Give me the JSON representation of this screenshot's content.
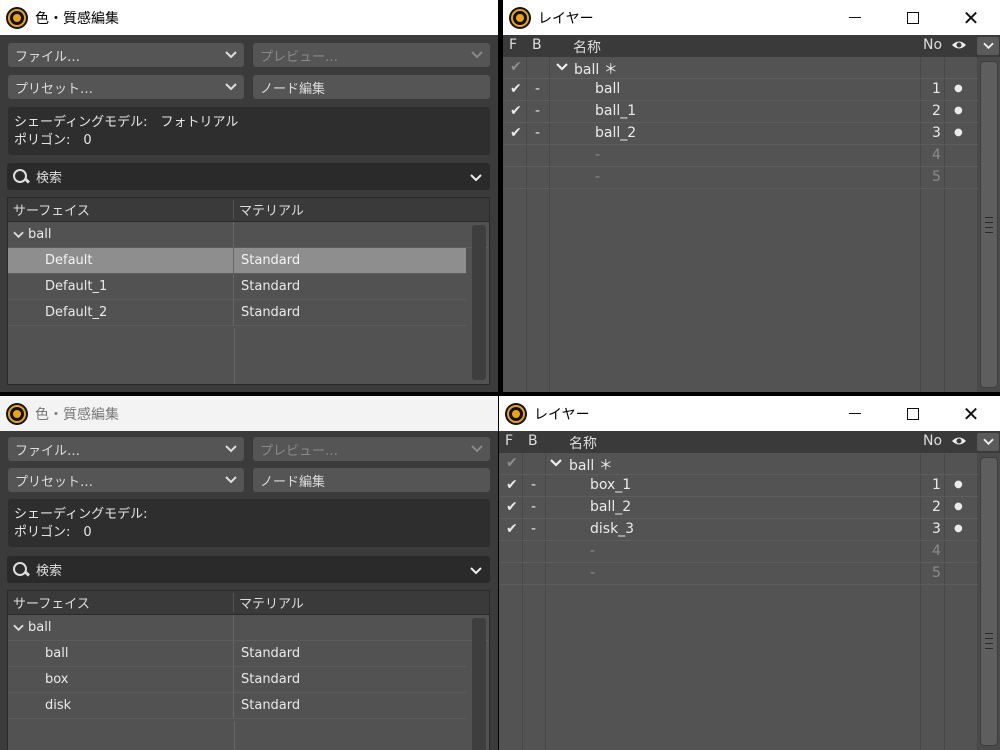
{
  "material_windows": [
    {
      "title": "色・質感編集",
      "file_label": "ファイル…",
      "preview_label": "プレビュー…",
      "preset_label": "プリセット…",
      "node_edit_label": "ノード編集",
      "info_line1": "シェーディングモデル:　フォトリアル",
      "info_line2": "ポリゴン:　0",
      "search_placeholder": "検索",
      "col_surface": "サーフェイス",
      "col_material": "マテリアル",
      "group": "ball",
      "rows": [
        {
          "surface": "Default",
          "material": "Standard"
        },
        {
          "surface": "Default_1",
          "material": "Standard"
        },
        {
          "surface": "Default_2",
          "material": "Standard"
        }
      ]
    },
    {
      "title": "色・質感編集",
      "file_label": "ファイル…",
      "preview_label": "プレビュー…",
      "preset_label": "プリセット…",
      "node_edit_label": "ノード編集",
      "info_line1": "シェーディングモデル:",
      "info_line2": "ポリゴン:　0",
      "search_placeholder": "検索",
      "col_surface": "サーフェイス",
      "col_material": "マテリアル",
      "group": "ball",
      "rows": [
        {
          "surface": "ball",
          "material": "Standard"
        },
        {
          "surface": "box",
          "material": "Standard"
        },
        {
          "surface": "disk",
          "material": "Standard"
        }
      ]
    }
  ],
  "layer_windows": [
    {
      "title": "レイヤー",
      "col_f": "F",
      "col_b": "B",
      "col_name": "名称",
      "col_no": "No",
      "group": "ball ＊",
      "check": "✔",
      "dash": "-",
      "dot": "●",
      "layers": [
        {
          "name": "ball",
          "no": "1"
        },
        {
          "name": "ball_1",
          "no": "2"
        },
        {
          "name": "ball_2",
          "no": "3"
        },
        {
          "name": "-",
          "no": "4"
        },
        {
          "name": "-",
          "no": "5"
        }
      ]
    },
    {
      "title": "レイヤー",
      "col_f": "F",
      "col_b": "B",
      "col_name": "名称",
      "col_no": "No",
      "group": "ball ＊",
      "check": "✔",
      "dash": "-",
      "dot": "●",
      "layers": [
        {
          "name": "box_1",
          "no": "1"
        },
        {
          "name": "ball_2",
          "no": "2"
        },
        {
          "name": "disk_3",
          "no": "3"
        },
        {
          "name": "-",
          "no": "4"
        },
        {
          "name": "-",
          "no": "5"
        }
      ]
    }
  ],
  "window_controls": {
    "minimize": "—",
    "maximize": "□",
    "close": "✕"
  }
}
